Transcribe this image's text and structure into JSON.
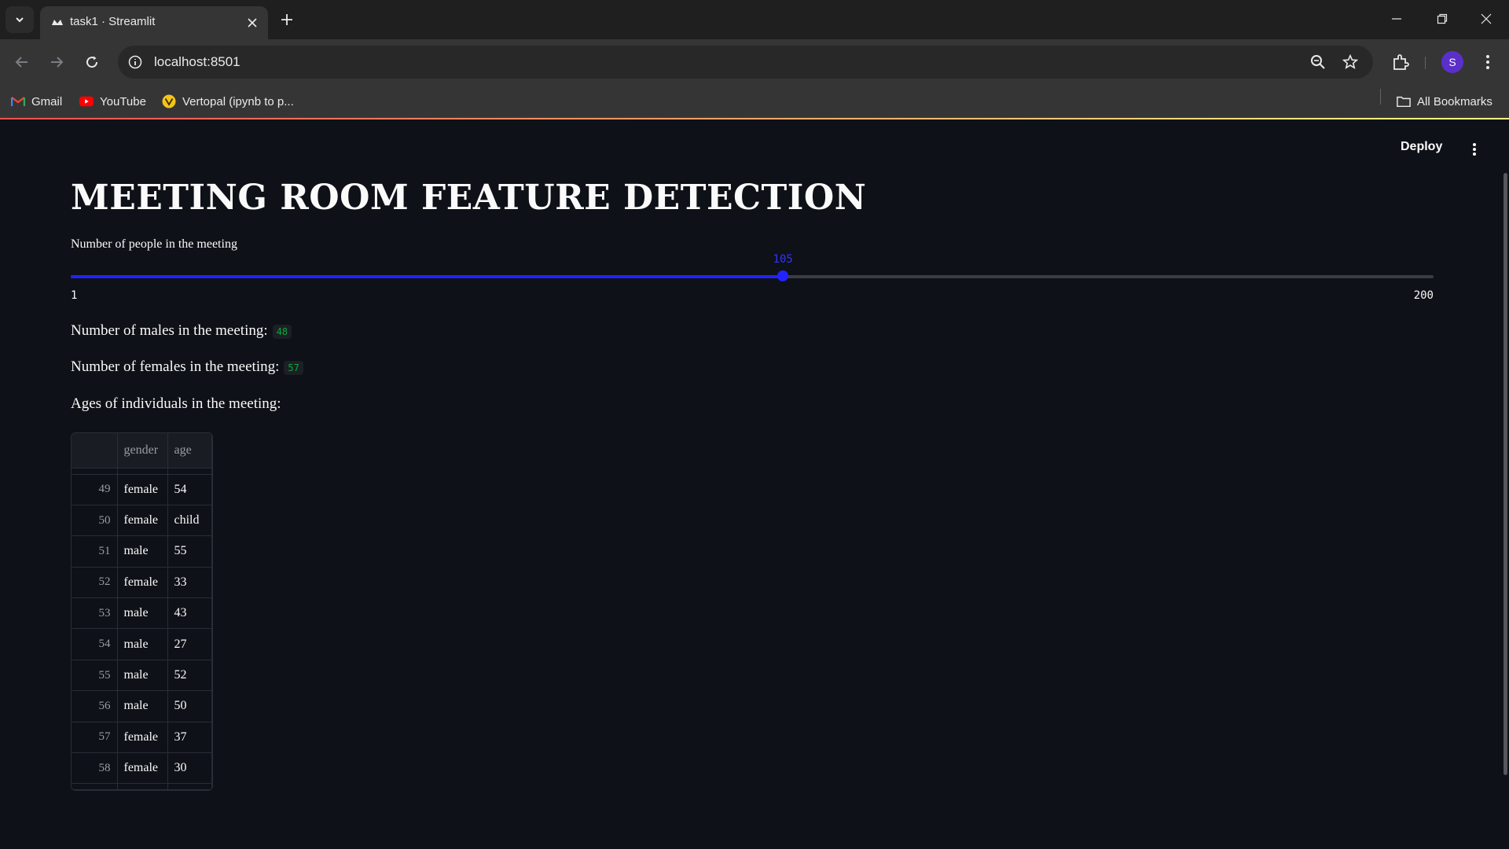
{
  "browser": {
    "tab_title": "task1 · Streamlit",
    "url": "localhost:8501",
    "profile_initial": "S",
    "bookmarks": [
      {
        "label": "Gmail",
        "icon": "gmail-icon"
      },
      {
        "label": "YouTube",
        "icon": "youtube-icon"
      },
      {
        "label": "Vertopal (ipynb to p...",
        "icon": "vertopal-icon"
      }
    ],
    "all_bookmarks": "All Bookmarks"
  },
  "app": {
    "deploy_label": "Deploy",
    "title": "MEETING ROOM FEATURE DETECTION",
    "slider": {
      "label": "Number of people in the meeting",
      "min": 1,
      "max": 200,
      "value": 105,
      "min_label": "1",
      "max_label": "200",
      "value_label": "105",
      "color": "#2323ff"
    },
    "males": {
      "label": "Number of males in the meeting:",
      "value": "48"
    },
    "females": {
      "label": "Number of females in the meeting:",
      "value": "57"
    },
    "ages_heading": "Ages of individuals in the meeting:",
    "table": {
      "columns": [
        "",
        "gender",
        "age"
      ],
      "rows": [
        {
          "index": "49",
          "gender": "female",
          "age": "54"
        },
        {
          "index": "50",
          "gender": "female",
          "age": "child"
        },
        {
          "index": "51",
          "gender": "male",
          "age": "55"
        },
        {
          "index": "52",
          "gender": "female",
          "age": "33"
        },
        {
          "index": "53",
          "gender": "male",
          "age": "43"
        },
        {
          "index": "54",
          "gender": "male",
          "age": "27"
        },
        {
          "index": "55",
          "gender": "male",
          "age": "52"
        },
        {
          "index": "56",
          "gender": "male",
          "age": "50"
        },
        {
          "index": "57",
          "gender": "female",
          "age": "37"
        },
        {
          "index": "58",
          "gender": "female",
          "age": "30"
        }
      ]
    }
  }
}
